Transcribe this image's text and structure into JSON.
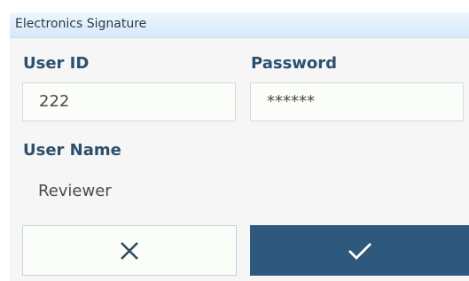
{
  "dialog": {
    "title": "Electronics Signature",
    "user_id": {
      "label": "User ID",
      "value": "222"
    },
    "password": {
      "label": "Password",
      "value": "******"
    },
    "user_name": {
      "label": "User Name",
      "value": "Reviewer"
    },
    "buttons": {
      "cancel": {
        "icon": "close-icon"
      },
      "confirm": {
        "icon": "checkmark-icon"
      }
    },
    "colors": {
      "accent": "#2f587d",
      "label": "#2d4f6f"
    }
  }
}
